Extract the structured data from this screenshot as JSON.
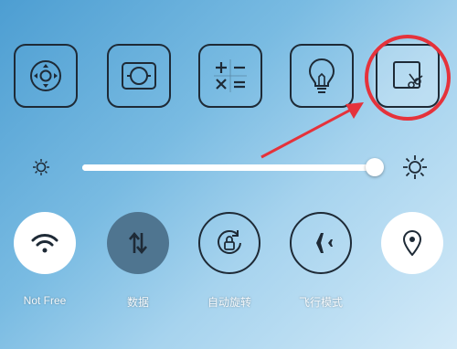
{
  "colors": {
    "background_from": "#4d9ed2",
    "background_to": "#d3eaf8",
    "outline": "#1e2a36",
    "annotation_red": "#e5323b",
    "active_dark": "#4f7590",
    "active_light": "#ffffff"
  },
  "shortcuts": [
    {
      "name": "remote-control",
      "icon": "remote-dpad-icon"
    },
    {
      "name": "screenshot",
      "icon": "screenshot-camera-icon"
    },
    {
      "name": "calculator",
      "icon": "calculator-icon"
    },
    {
      "name": "flashlight",
      "icon": "lightbulb-icon"
    },
    {
      "name": "screen-capture",
      "icon": "crop-scissors-icon",
      "highlighted": true
    }
  ],
  "brightness": {
    "level": 1.0
  },
  "toggles": [
    {
      "label": "Not Free",
      "icon": "wifi-icon",
      "state": "on"
    },
    {
      "label": "数据",
      "icon": "data-arrows-icon",
      "state": "on"
    },
    {
      "label": "自动旋转",
      "icon": "rotation-lock-icon",
      "state": "off"
    },
    {
      "label": "飞行模式",
      "icon": "airplane-icon",
      "state": "off"
    },
    {
      "label": "",
      "icon": "location-pin-icon",
      "state": "on"
    }
  ]
}
